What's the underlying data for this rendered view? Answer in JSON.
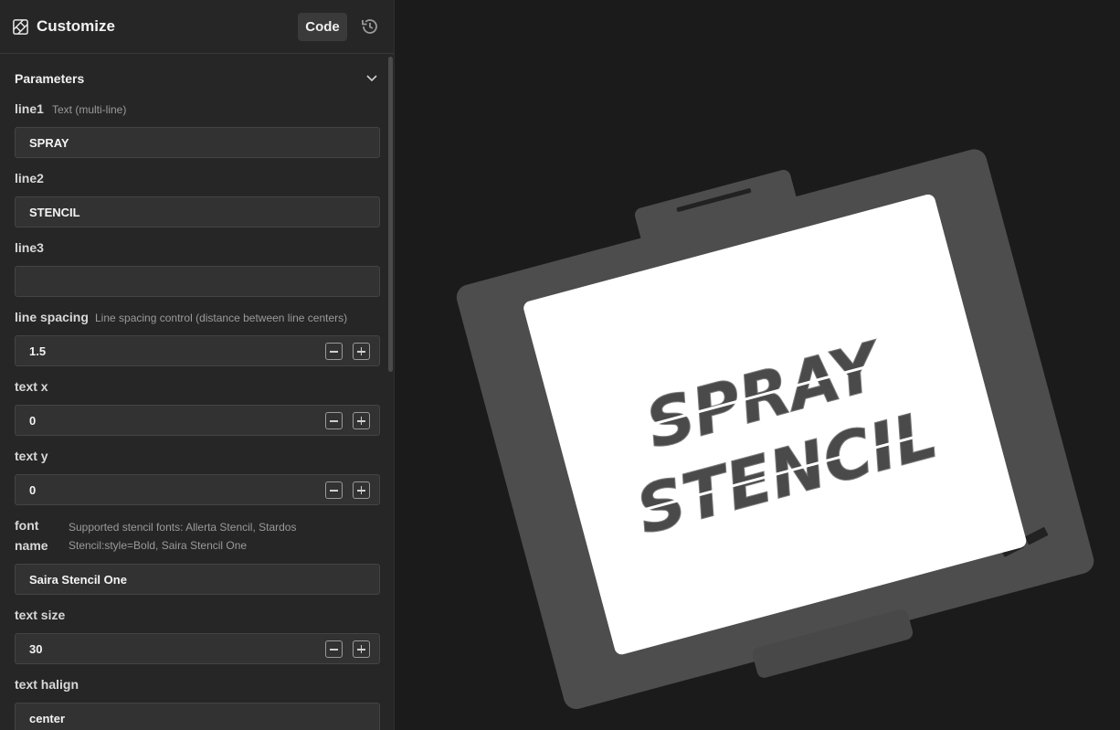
{
  "header": {
    "title": "Customize",
    "code_label": "Code"
  },
  "parameters": {
    "section_title": "Parameters",
    "line1": {
      "label": "line1",
      "hint": "Text (multi-line)",
      "value": "SPRAY"
    },
    "line2": {
      "label": "line2",
      "value": "STENCIL"
    },
    "line3": {
      "label": "line3",
      "value": ""
    },
    "line_spacing": {
      "label": "line spacing",
      "hint": "Line spacing control (distance between line centers)",
      "value": "1.5"
    },
    "text_x": {
      "label": "text x",
      "value": "0"
    },
    "text_y": {
      "label": "text y",
      "value": "0"
    },
    "font_name": {
      "label_line1": "font",
      "label_line2": "name",
      "hint_line1": "Supported stencil fonts: Allerta Stencil, Stardos",
      "hint_line2": "Stencil:style=Bold, Saira Stencil One",
      "value": "Saira Stencil One"
    },
    "text_size": {
      "label": "text size",
      "value": "30"
    },
    "text_halign": {
      "label": "text halign",
      "value": "center"
    }
  },
  "preview": {
    "line1": "SPRAY",
    "line2": "STENCIL"
  },
  "colors": {
    "panel_bg": "#262626",
    "viewport_bg": "#1b1b1b",
    "stencil_frame": "#4d4d4d",
    "stencil_plate": "#ffffff",
    "stencil_text": "#4a4a4a"
  }
}
